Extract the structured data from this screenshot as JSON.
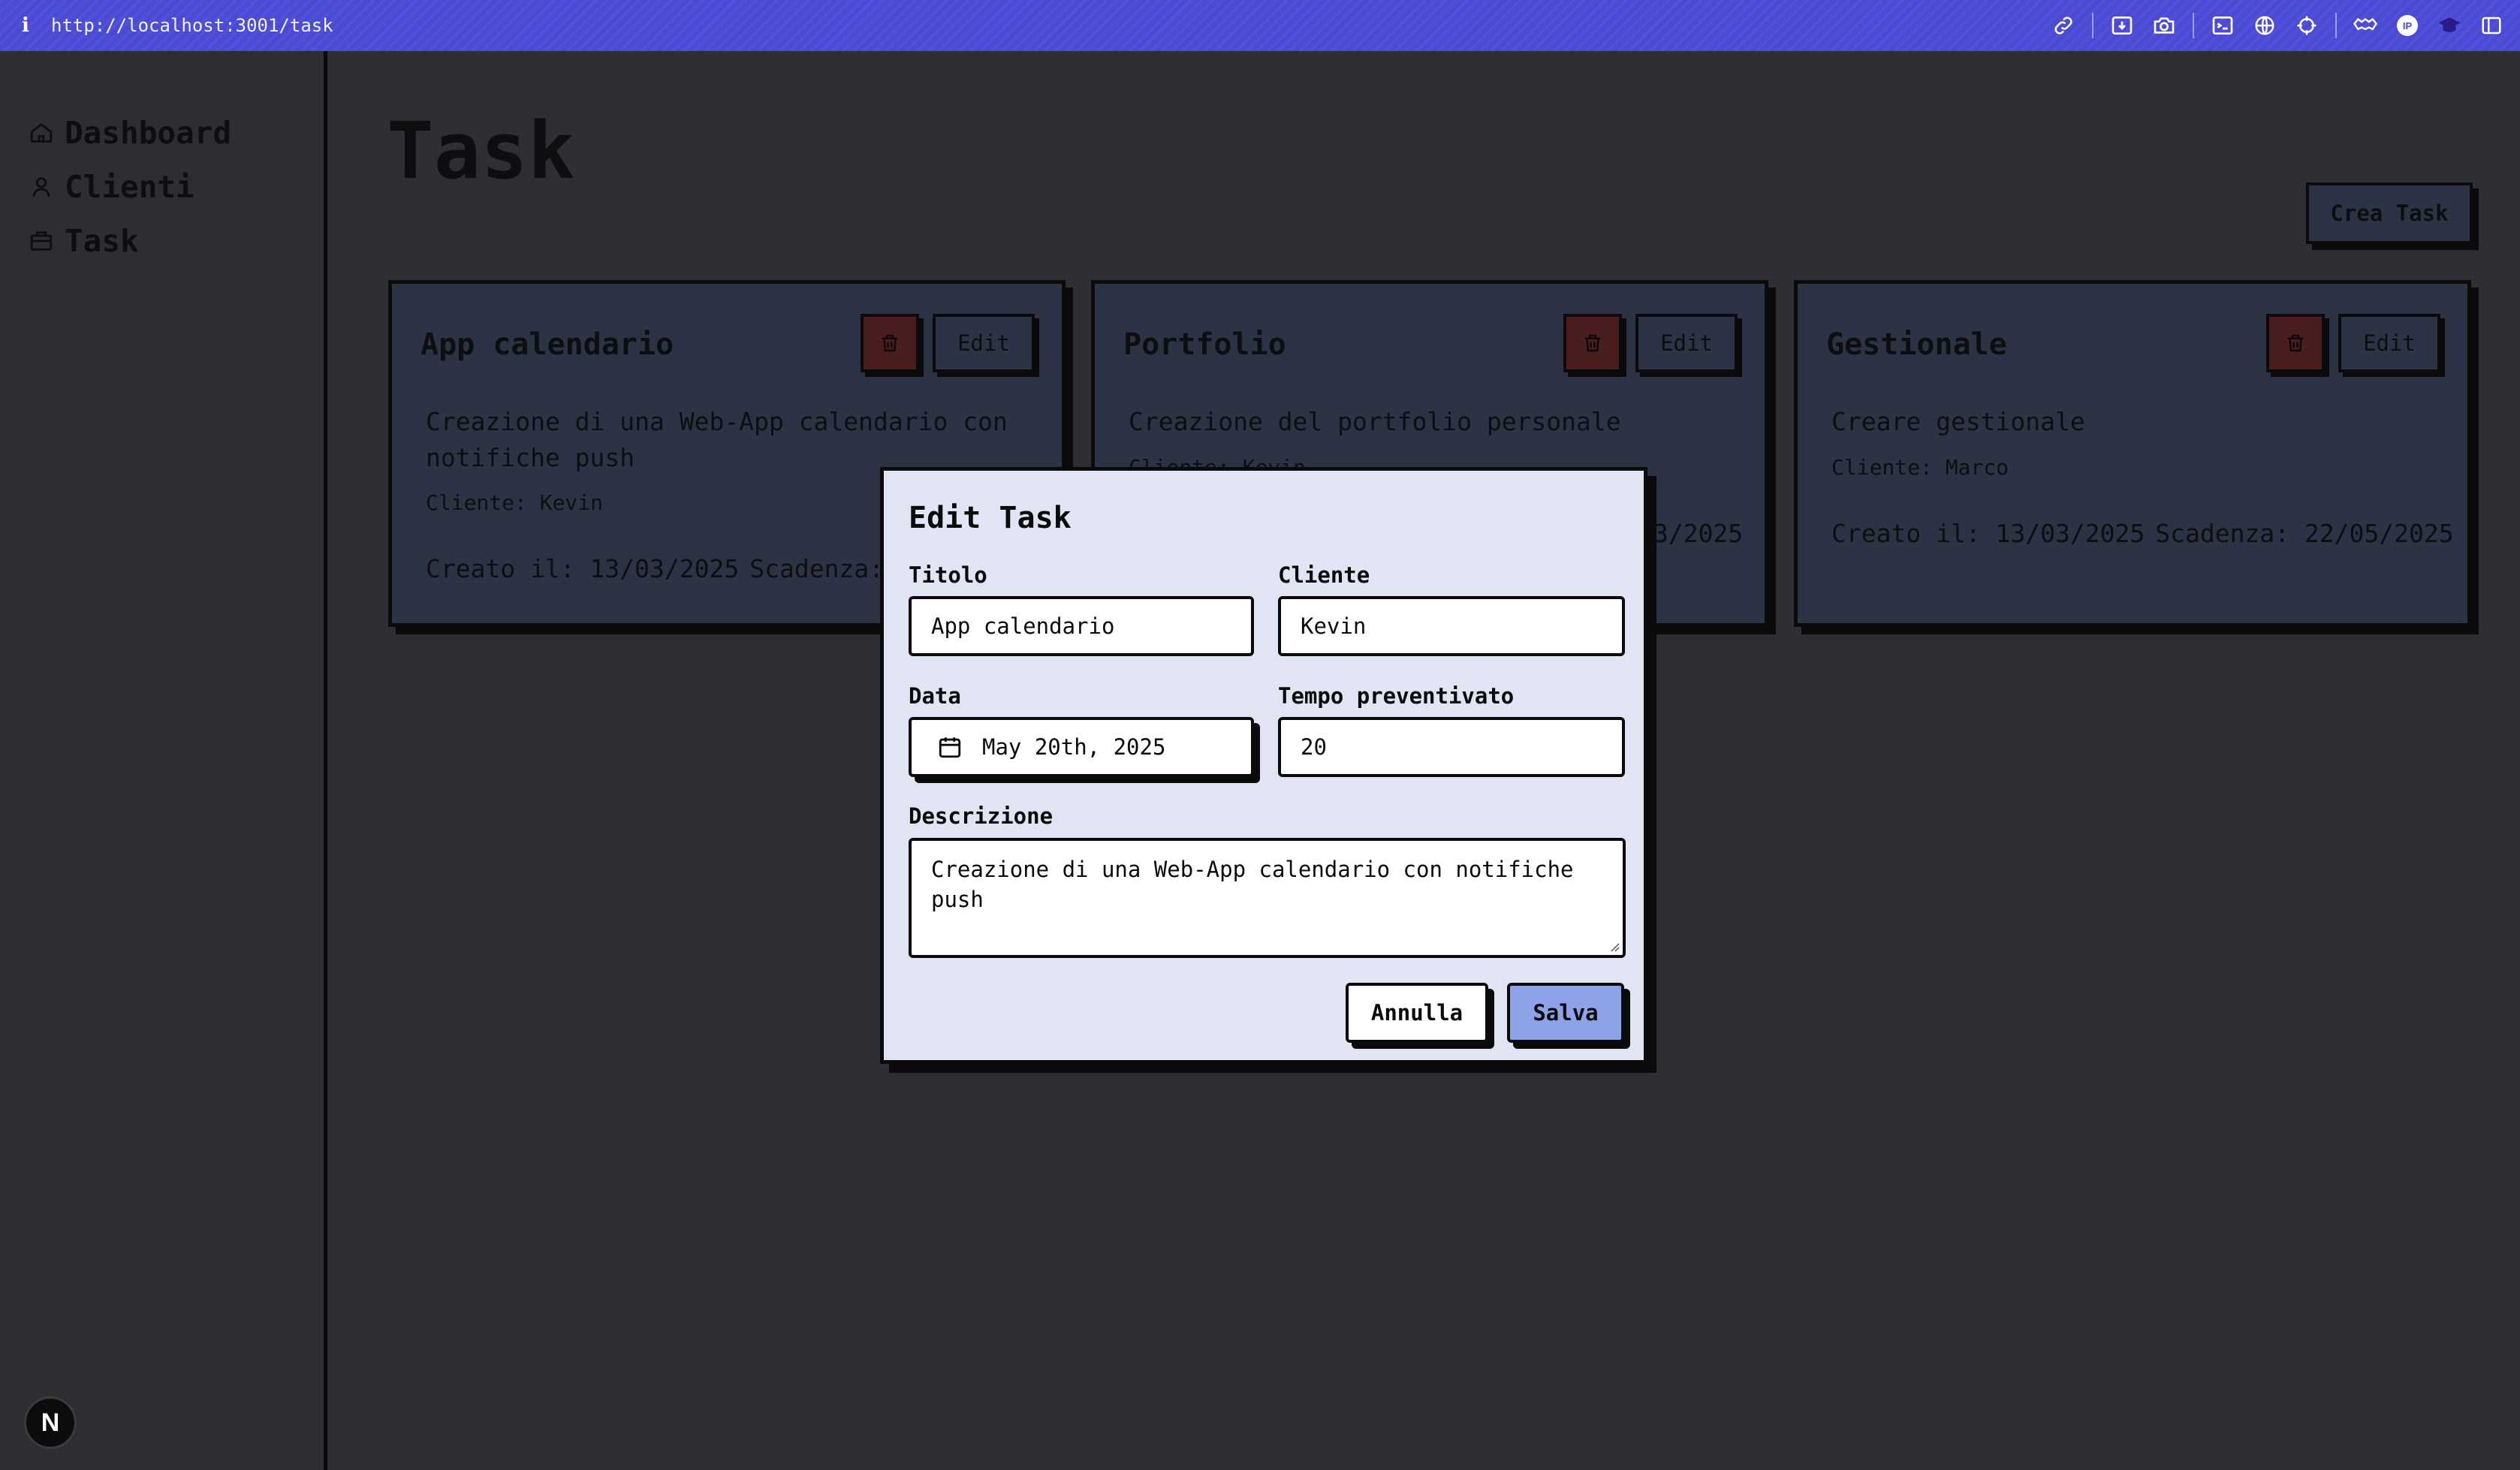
{
  "browser": {
    "info_glyph": "i",
    "url": "http://localhost:3001/task",
    "toolbar_icons": [
      "link-icon",
      "download-icon",
      "camera-icon",
      "terminal-icon",
      "globe-icon",
      "crosshair-icon",
      "extensions-icon",
      "profile-badge-icon",
      "graduation-cap-icon",
      "sidebar-toggle-icon"
    ],
    "profile_badge_text": "IP"
  },
  "sidebar": {
    "items": [
      {
        "label": "Dashboard",
        "icon": "home-icon"
      },
      {
        "label": "Clienti",
        "icon": "user-icon"
      },
      {
        "label": "Task",
        "icon": "briefcase-icon"
      }
    ],
    "framework_badge": "N"
  },
  "main": {
    "title": "Task",
    "create_button": "Crea Task",
    "cards": [
      {
        "title": "App calendario",
        "edit": "Edit",
        "description": "Creazione di una Web-App calendario con notifiche push",
        "client": "Cliente: Kevin",
        "created": "Creato il: 13/03/2025",
        "deadline": "Scadenza:"
      },
      {
        "title": "Portfolio",
        "edit": "Edit",
        "description": "Creazione del portfolio personale",
        "client": "Cliente: Kevin",
        "created": "",
        "deadline": "3/2025"
      },
      {
        "title": "Gestionale",
        "edit": "Edit",
        "description": "Creare gestionale",
        "client": "Cliente: Marco",
        "created": "Creato il: 13/03/2025",
        "deadline": "Scadenza: 22/05/2025"
      }
    ]
  },
  "modal": {
    "title": "Edit Task",
    "fields": {
      "titolo": {
        "label": "Titolo",
        "value": "App calendario"
      },
      "cliente": {
        "label": "Cliente",
        "value": "Kevin"
      },
      "data": {
        "label": "Data",
        "value": "May 20th, 2025"
      },
      "tempo": {
        "label": "Tempo preventivato",
        "value": "20"
      },
      "descrizione": {
        "label": "Descrizione",
        "value": "Creazione di una Web-App calendario con notifiche push"
      }
    },
    "cancel_button": "Annulla",
    "save_button": "Salva"
  },
  "colors": {
    "topbar": "#4a4ad6",
    "page_background": "#2e2f33",
    "card_background": "#2b3345",
    "modal_background": "#e1e5f3",
    "save_button": "#8ea2ea",
    "delete_button": "#4a1d1f",
    "border": "#0b0b0c"
  }
}
